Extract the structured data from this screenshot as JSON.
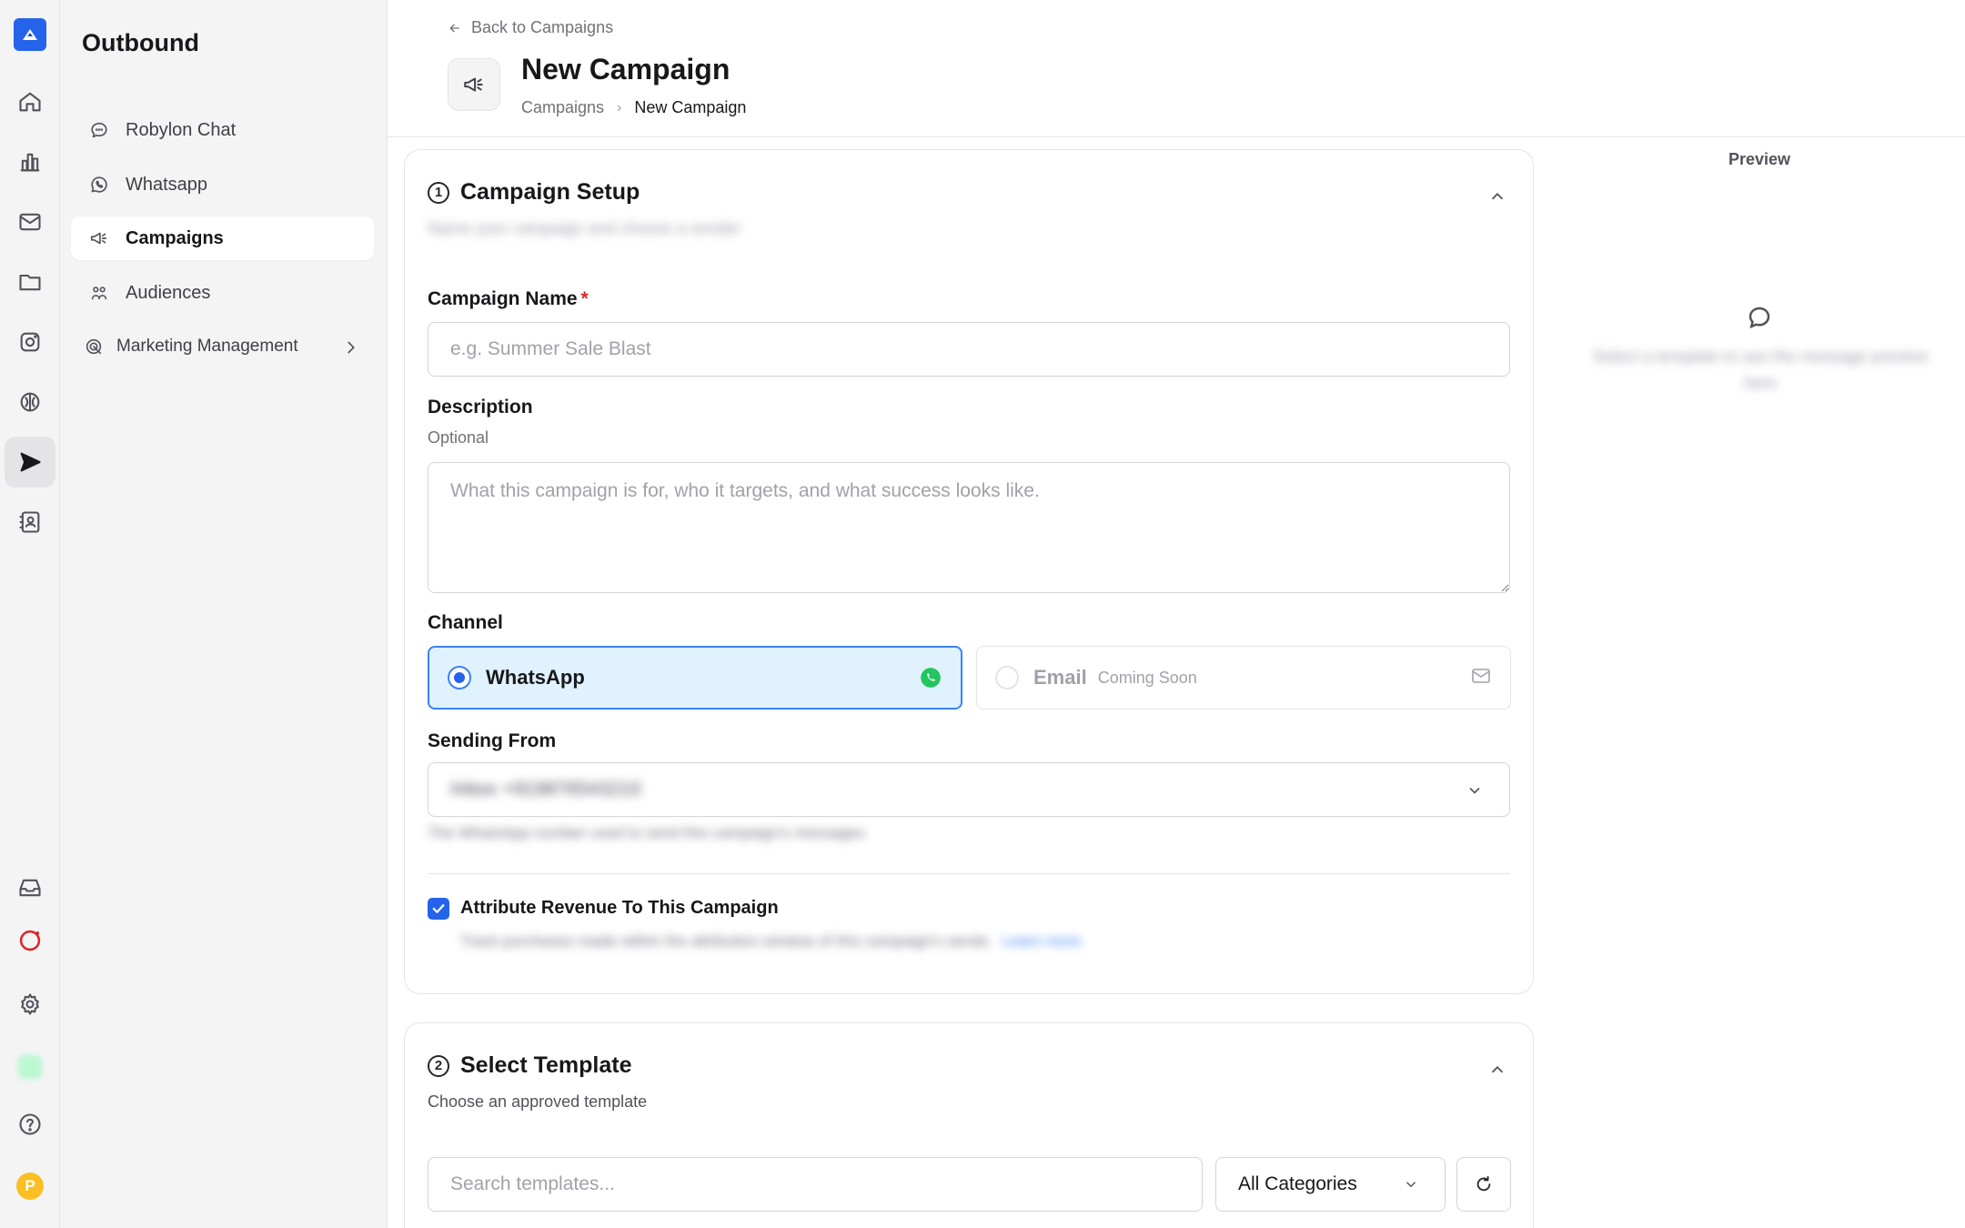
{
  "app": {
    "section_title": "Outbound"
  },
  "rail": {
    "items": [
      {
        "icon": "home-icon"
      },
      {
        "icon": "analytics-icon"
      },
      {
        "icon": "mail-icon"
      },
      {
        "icon": "folder-icon"
      },
      {
        "icon": "instagram-icon"
      },
      {
        "icon": "brain-icon"
      },
      {
        "icon": "send-icon"
      },
      {
        "icon": "contacts-icon"
      },
      {
        "icon": "inbox-icon"
      },
      {
        "icon": "status-ring-icon"
      },
      {
        "icon": "settings-icon"
      },
      {
        "icon": "help-icon"
      }
    ],
    "avatar_initial": "P"
  },
  "subnav": {
    "items": [
      {
        "label": "Robylon Chat",
        "icon": "chat-bubble-icon"
      },
      {
        "label": "Whatsapp",
        "icon": "whatsapp-icon"
      },
      {
        "label": "Campaigns",
        "icon": "megaphone-icon",
        "active": true
      },
      {
        "label": "Audiences",
        "icon": "people-icon"
      },
      {
        "label": "Marketing Management",
        "icon": "target-icon",
        "has_children": true
      }
    ]
  },
  "header": {
    "back_label": "Back to Campaigns",
    "title": "New Campaign",
    "breadcrumb": [
      "Campaigns",
      "New Campaign"
    ]
  },
  "setup": {
    "step": "1",
    "title": "Campaign Setup",
    "subtitle_blurred": "Name your campaign and choose a sender",
    "campaign_name": {
      "label": "Campaign Name",
      "required": "*",
      "placeholder": "e.g. Summer Sale Blast",
      "value": ""
    },
    "description": {
      "label": "Description",
      "hint": "Optional",
      "placeholder": "What this campaign is for, who it targets, and what success looks like.",
      "value": ""
    },
    "channel": {
      "label": "Channel",
      "options": [
        {
          "label": "WhatsApp",
          "selected": true
        },
        {
          "label": "Email",
          "badge": "Coming Soon",
          "disabled": true
        }
      ]
    },
    "sending_from": {
      "label": "Sending From",
      "value_blurred": "Inbox +919876543210",
      "hint_blurred": "The WhatsApp number used to send this campaign's messages"
    },
    "attribute_revenue": {
      "label": "Attribute Revenue To This Campaign",
      "checked": true,
      "hint_blurred": "Track purchases made within the attribution window of this campaign's sends.",
      "link_blurred": "Learn more"
    }
  },
  "template": {
    "step": "2",
    "title": "Select Template",
    "subtitle": "Choose an approved template",
    "search_placeholder": "Search templates...",
    "category_value": "All Categories"
  },
  "preview": {
    "label": "Preview",
    "empty_blurred": "Select a template to see the message preview here"
  },
  "colors": {
    "accent": "#2563eb",
    "selected_bg": "#e0f2fe",
    "whatsapp": "#22c55e",
    "required": "#dc2626"
  }
}
